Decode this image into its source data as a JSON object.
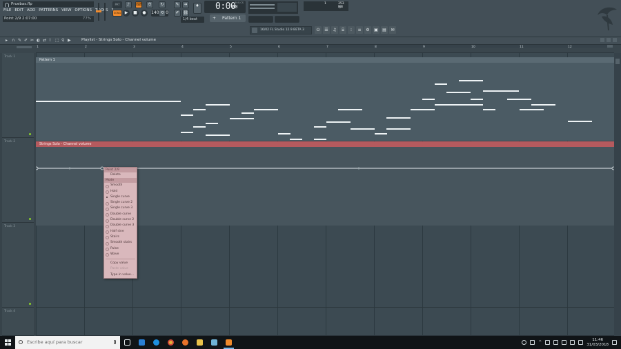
{
  "window": {
    "project_file": "Pruebas.flp",
    "menu": [
      "FILE",
      "EDIT",
      "ADD",
      "PATTERNS",
      "VIEW",
      "OPTIONS",
      "TOOLS",
      "?"
    ],
    "hint": "Point 2/9 2:07:00",
    "hint_pct": "77%"
  },
  "transport": {
    "pat_song": "SONG",
    "bpm": "140.000",
    "time": "0:00",
    "time_small": "00",
    "time_unit": "M:S:CS",
    "pattern": "Pattern 1",
    "step": "1/4 beat"
  },
  "monitor": {
    "cpu_value": "1",
    "ram": "353 MB",
    "voices": "0"
  },
  "news": {
    "text": "16/02 FL Studio 12.9 BETA 3"
  },
  "playlist": {
    "title": "Playlist - Strings Solo - Channel volume",
    "ruler_numbers": [
      "1",
      "2",
      "3",
      "4",
      "5",
      "6",
      "7",
      "8",
      "9",
      "10",
      "11",
      "12"
    ],
    "tracks": [
      "Track 1",
      "Track 2",
      "Track 3",
      "Track 4"
    ],
    "pattern_clip_label": "Pattern 1",
    "automation_clip_label": "Strings Solo - Channel volume"
  },
  "context_menu": {
    "header_point": "Point 2/9",
    "header_mode": "Mode",
    "delete": "Delete",
    "modes": [
      "Smooth",
      "Hold",
      "Single curve",
      "Single curve 2",
      "Single curve 3",
      "Double curve",
      "Double curve 2",
      "Double curve 3",
      "Half sine",
      "Stairs",
      "Smooth stairs",
      "Pulse",
      "Wave"
    ],
    "selected_mode": "Single curve",
    "copy_value": "Copy value",
    "paste_value": "Paste value",
    "type_in_value": "Type in value..."
  },
  "taskbar": {
    "search_placeholder": "Escribe aquí para buscar",
    "time": "11:46",
    "date": "31/03/2018"
  }
}
